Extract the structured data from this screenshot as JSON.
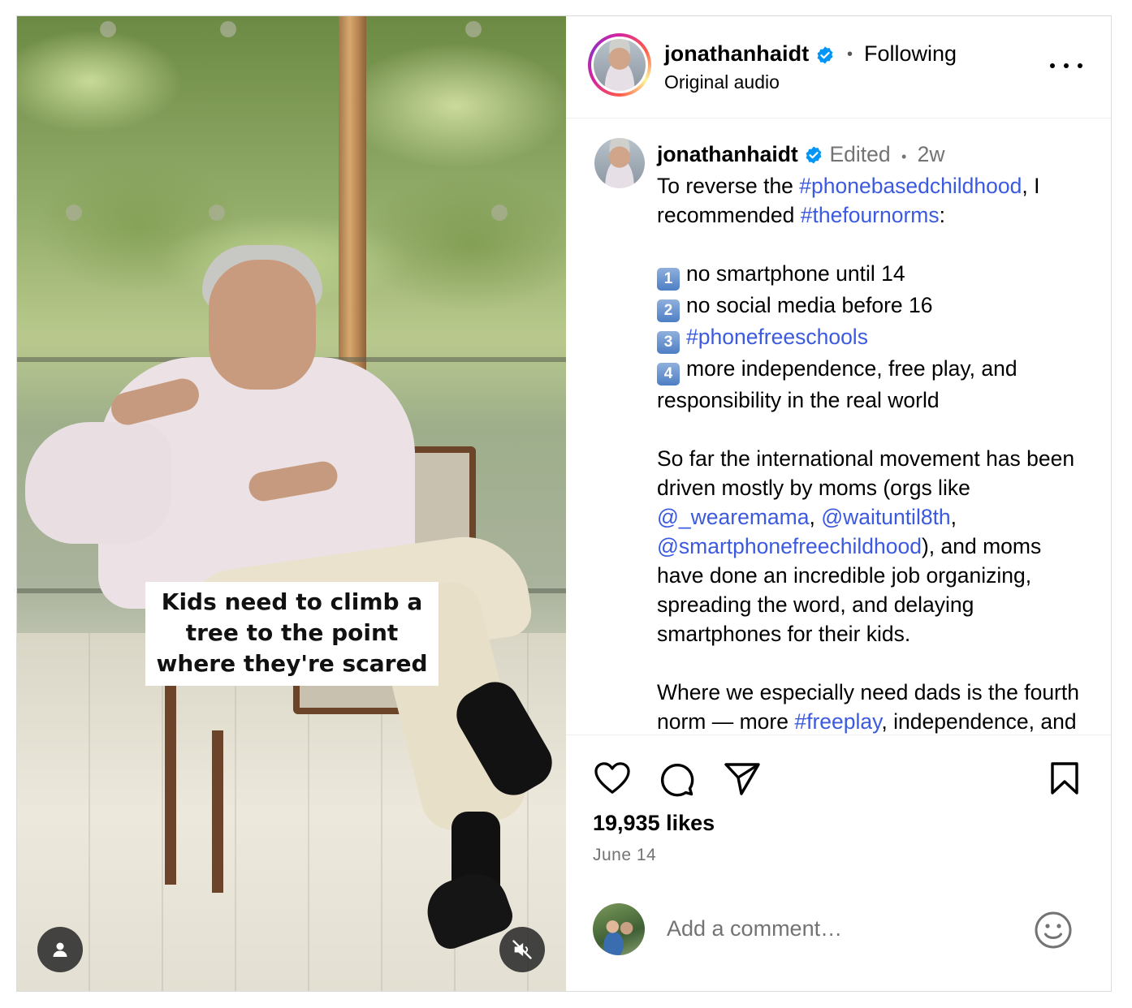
{
  "video": {
    "caption_lines": [
      "Kids need to climb a",
      "tree to the point",
      "where they're scared"
    ],
    "user_icon": "user-icon",
    "mute_icon": "muted-speaker-icon"
  },
  "header": {
    "username": "jonathanhaidt",
    "separator": "•",
    "follow_status": "Following",
    "audio": "Original audio",
    "more_icon": "more-options-icon"
  },
  "post": {
    "username": "jonathanhaidt",
    "edited": "Edited",
    "separator": "•",
    "time_ago": "2w",
    "text": {
      "intro_a": "To reverse the ",
      "tag1": "#phonebasedchildhood",
      "intro_b": ", I recommended ",
      "tag2": "#thefournorms",
      "intro_c": ":",
      "norm1_num": "1",
      "norm1": "no smartphone until 14",
      "norm2_num": "2",
      "norm2": "no social media before 16",
      "norm3_num": "3",
      "norm3": "#phonefreeschools",
      "norm4_num": "4",
      "norm4": "more independence, free play, and responsibility in the real world",
      "p2_a": "So far the international movement has been driven mostly by moms (orgs like ",
      "mention1": "@_wearemama",
      "comma1": ", ",
      "mention2": "@waituntil8th",
      "comma2": ", ",
      "mention3": "@smartphonefreechildhood",
      "p2_b": "), and moms have done an incredible job organizing, spreading the word, and delaying smartphones for their kids.",
      "p3_a": "Where we especially need dads is the fourth norm — more ",
      "tag3": "#freeplay",
      "p3_b": ", independence, and responsibility in the real world"
    }
  },
  "actions": {
    "like_icon": "heart-icon",
    "comment_icon": "comment-icon",
    "share_icon": "send-icon",
    "save_icon": "bookmark-icon",
    "likes": "19,935 likes",
    "date": "June 14"
  },
  "comment_box": {
    "placeholder": "Add a comment…",
    "emoji_icon": "smiley-icon"
  },
  "colors": {
    "link": "#3b5ae0",
    "verified": "#0095f6",
    "muted_text": "#737373"
  }
}
